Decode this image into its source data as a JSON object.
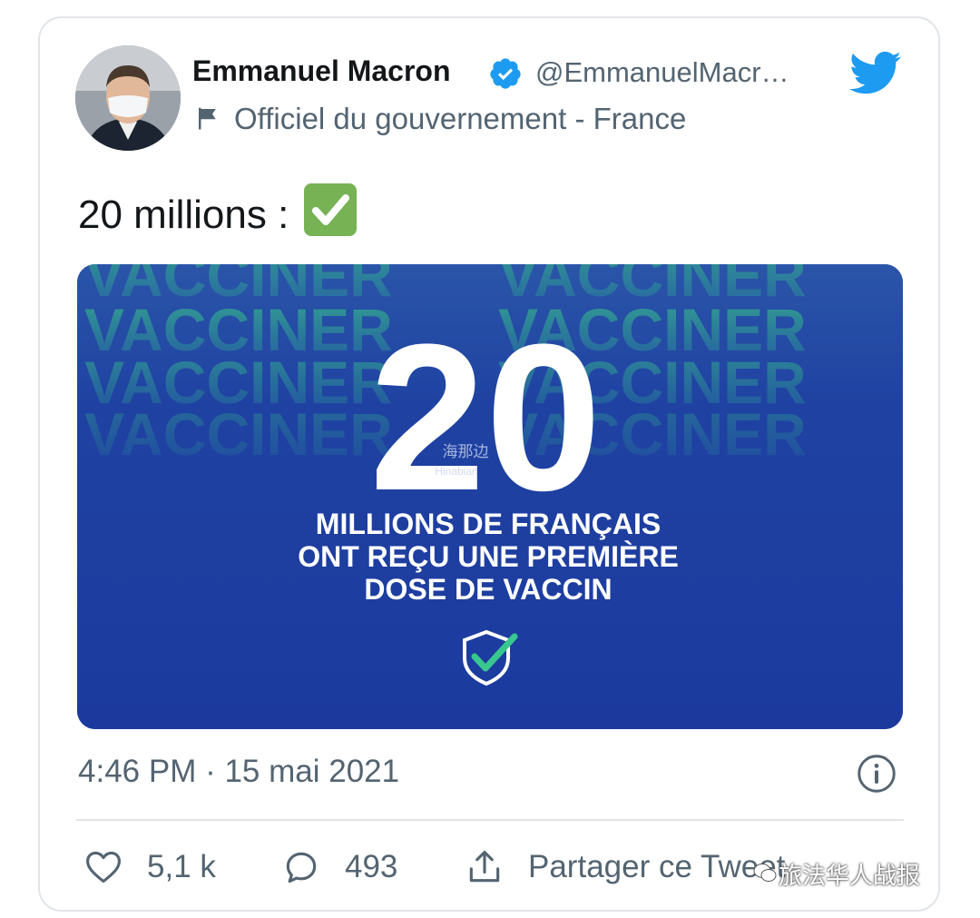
{
  "author": {
    "name": "Emmanuel Macron",
    "handle": "@EmmanuelMacr…",
    "affiliation": "Officiel du gouvernement - France"
  },
  "tweet": {
    "text": "20 millions :",
    "emoji": "white-heavy-check-mark-emoji"
  },
  "media": {
    "background_word": "VACCINER",
    "big_number": "20",
    "caption_line1": "MILLIONS DE FRANÇAIS",
    "caption_line2": "ONT REÇU UNE PREMIÈRE",
    "caption_line3": "DOSE DE VACCIN",
    "watermark_cn": "海那边",
    "watermark_en": "Hinabian",
    "bg_color": "#1f3fa0",
    "pattern_color": "#2e9a8a"
  },
  "meta": {
    "timestamp": "4:46 PM · 15 mai 2021"
  },
  "actions": {
    "likes": "5,1 k",
    "replies": "493",
    "share_label": "Partager ce Tweet"
  },
  "overlay_watermark": "旅法华人战报",
  "colors": {
    "twitter_blue": "#1d9bf0",
    "text": "#14171a",
    "secondary": "#536471"
  }
}
